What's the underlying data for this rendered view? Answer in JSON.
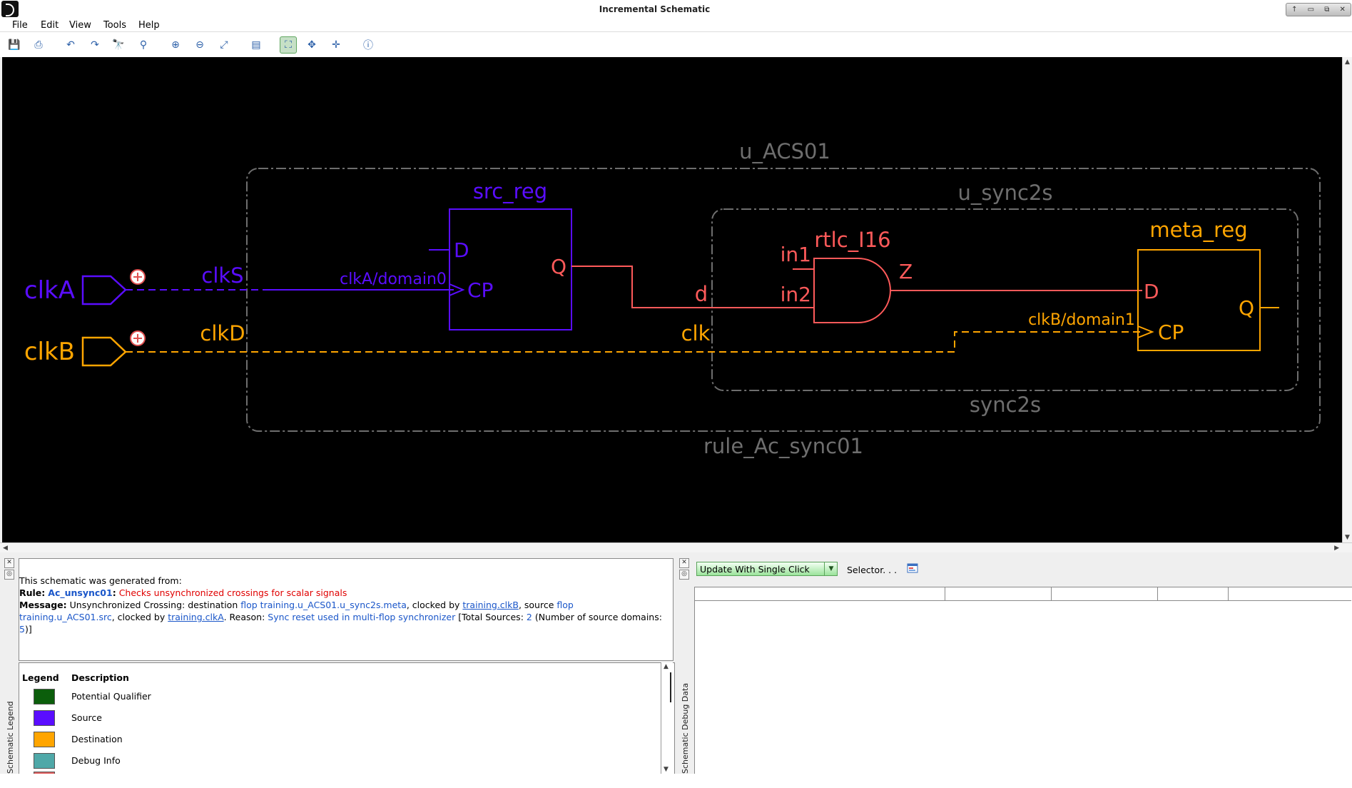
{
  "window": {
    "title": "Incremental Schematic",
    "controls": [
      "↑",
      "▭",
      "⧉",
      "✕"
    ]
  },
  "menu": [
    "File",
    "Edit",
    "View",
    "Tools",
    "Help"
  ],
  "toolbar": [
    {
      "name": "save-icon",
      "glyph": "💾"
    },
    {
      "name": "print-icon",
      "glyph": "⎙"
    },
    {
      "name": "undo-icon",
      "glyph": "↶"
    },
    {
      "name": "redo-icon",
      "glyph": "↷"
    },
    {
      "name": "find-icon",
      "glyph": "🔭"
    },
    {
      "name": "trace-icon",
      "glyph": "⚲"
    },
    {
      "name": "zoom-in-icon",
      "glyph": "⊕"
    },
    {
      "name": "zoom-out-icon",
      "glyph": "⊖"
    },
    {
      "name": "zoom-fit-icon",
      "glyph": "⤢"
    },
    {
      "name": "properties-icon",
      "glyph": "▤"
    },
    {
      "name": "select-mode-icon",
      "glyph": "⛶",
      "active": true
    },
    {
      "name": "pan-icon",
      "glyph": "✥"
    },
    {
      "name": "move-icon",
      "glyph": "✛"
    },
    {
      "name": "info-icon",
      "glyph": "ⓘ"
    }
  ],
  "schematic": {
    "colors": {
      "source": "#5a0dff",
      "destination": "#ffa500",
      "sync": "#ff5a5a",
      "box": "#6e6e6e",
      "background": "#000000"
    },
    "groups": {
      "outer": "u_ACS01",
      "outer_footer": "rule_Ac_sync01",
      "inner": "u_sync2s",
      "inner_footer": "sync2s"
    },
    "ports": [
      {
        "name": "clkA",
        "role": "source"
      },
      {
        "name": "clkB",
        "role": "destination"
      }
    ],
    "nets": {
      "clkS": "clkS",
      "clkD": "clkD",
      "clkA_domain": "clkA/domain0",
      "clkB_domain": "clkB/domain1",
      "d": "d",
      "clk": "clk"
    },
    "src_reg": {
      "name": "src_reg",
      "pins": [
        "D",
        "CP",
        "Q"
      ]
    },
    "gate": {
      "name": "rtlc_I16",
      "pins": [
        "in1",
        "in2",
        "Z"
      ]
    },
    "meta_reg": {
      "name": "meta_reg",
      "pins": [
        "D",
        "CP",
        "Q"
      ]
    }
  },
  "info": {
    "intro": "This schematic was generated from:",
    "rule_label": "Rule:",
    "rule_name": "Ac_unsync01",
    "rule_sep": ":",
    "rule_desc": "Checks unsynchronized crossings for scalar signals",
    "msg_label": "Message:",
    "msg_1": "Unsynchronized Crossing: destination",
    "dest_flop": "flop training.u_ACS01.u_sync2s.meta",
    "msg_2": ", clocked by",
    "dest_clock": "training.clkB",
    "msg_3": ", source",
    "src_flop": "flop training.u_ACS01.src",
    "msg_4": ", clocked by",
    "src_clock": "training.clkA",
    "msg_5": ". Reason:",
    "reason": "Sync reset used in multi-flop synchronizer",
    "msg_6": "[Total Sources:",
    "total_sources": "2",
    "msg_7": "(Number of source domains:",
    "domains": "5",
    "msg_8": ")]"
  },
  "legend": {
    "col_legend": "Legend",
    "col_desc": "Description",
    "rows": [
      {
        "label": "Potential Qualifier",
        "color": "#0b5e0b"
      },
      {
        "label": "Source",
        "color": "#5a0dff"
      },
      {
        "label": "Destination",
        "color": "#ffa500"
      },
      {
        "label": "Debug Info",
        "color": "#4fa8a8"
      },
      {
        "label": "",
        "color": "#e06060"
      }
    ],
    "side_label": "Schematic Legend"
  },
  "debug": {
    "side_label": "Schematic Debug Data",
    "update_mode": "Update With Single Click",
    "selector": "Selector. . ."
  }
}
